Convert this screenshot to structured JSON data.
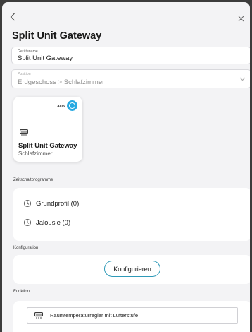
{
  "header": {
    "back_icon": "chevron-left-icon",
    "close_icon": "close-icon",
    "title": "Split Unit Gateway"
  },
  "fields": {
    "name": {
      "label": "Gerätename",
      "value": "Split Unit Gateway"
    },
    "position": {
      "label": "Position",
      "value": "Erdgeschoss > Schlafzimmer"
    }
  },
  "device_card": {
    "state_badge": "AUS",
    "icon": "air-conditioner-icon",
    "title": "Split Unit Gateway",
    "room": "Schlafzimmer",
    "accent": "#27a9e1"
  },
  "timers": {
    "section_label": "Zeitschaltprogramme",
    "items": [
      {
        "label": "Grundprofil (0)",
        "icon": "clock-icon"
      },
      {
        "label": "Jalousie (0)",
        "icon": "clock-icon"
      }
    ]
  },
  "configuration": {
    "section_label": "Konfiguration",
    "button_label": "Konfigurieren",
    "button_color": "#2f9ab8"
  },
  "function": {
    "section_label": "Funktion",
    "item_label": "Raumtemperaturregler mit Lüfterstufe",
    "item_icon": "air-conditioner-icon"
  }
}
